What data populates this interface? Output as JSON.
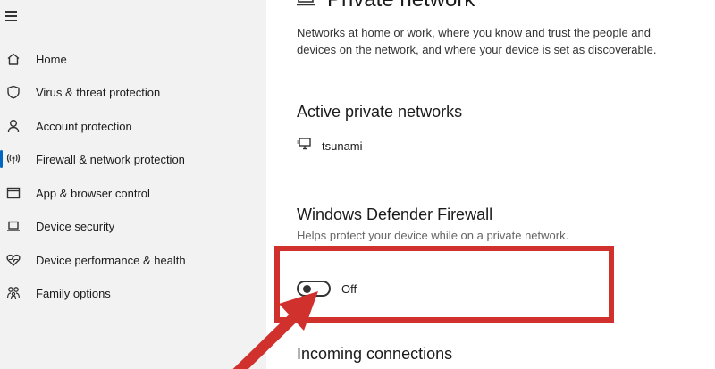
{
  "sidebar": {
    "items": [
      {
        "label": "Home",
        "icon": "home-icon"
      },
      {
        "label": "Virus & threat protection",
        "icon": "shield-icon"
      },
      {
        "label": "Account protection",
        "icon": "person-icon"
      },
      {
        "label": "Firewall & network protection",
        "icon": "antenna-icon",
        "active": true
      },
      {
        "label": "App & browser control",
        "icon": "browser-window-icon"
      },
      {
        "label": "Device security",
        "icon": "laptop-icon"
      },
      {
        "label": "Device performance & health",
        "icon": "heart-icon"
      },
      {
        "label": "Family options",
        "icon": "family-icon"
      }
    ]
  },
  "main": {
    "title": "Private network",
    "description": "Networks at home or work, where you know and trust the people and devices on the network, and where your device is set as discoverable.",
    "active_networks": {
      "heading": "Active private networks",
      "networks": [
        "tsunami"
      ]
    },
    "firewall": {
      "heading": "Windows Defender Firewall",
      "description": "Helps protect your device while on a private network.",
      "toggle_state": "Off",
      "toggle_on": false
    },
    "incoming": {
      "heading": "Incoming connections"
    }
  },
  "colors": {
    "annotation_red": "#d0312d",
    "accent_blue": "#0067c0",
    "sidebar_bg": "#f2f2f2"
  }
}
